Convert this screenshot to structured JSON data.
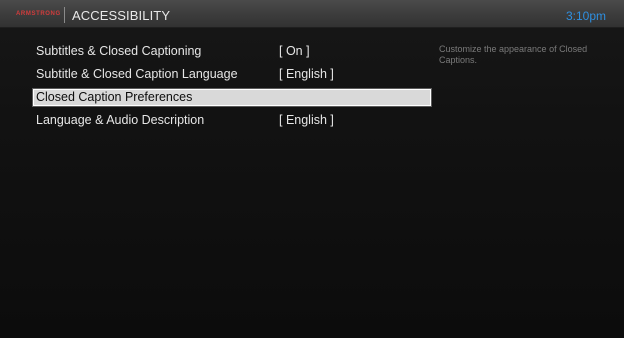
{
  "header": {
    "brand": "ARMSTRONG",
    "title": "ACCESSIBILITY",
    "time": "3:10pm"
  },
  "menu": {
    "items": [
      {
        "label": "Subtitles & Closed Captioning",
        "value": "[ On ]"
      },
      {
        "label": "Subtitle & Closed Caption Language",
        "value": "[ English ]"
      },
      {
        "label": "Closed Caption Preferences",
        "value": ""
      },
      {
        "label": "Language & Audio Description",
        "value": "[ English ]"
      }
    ],
    "selected_index": 2
  },
  "hint": {
    "text": "Customize the appearance of Closed Captions."
  },
  "colors": {
    "brand": "#d23b3b",
    "clock": "#2f8fe0",
    "highlight": "#d9d9d9"
  }
}
